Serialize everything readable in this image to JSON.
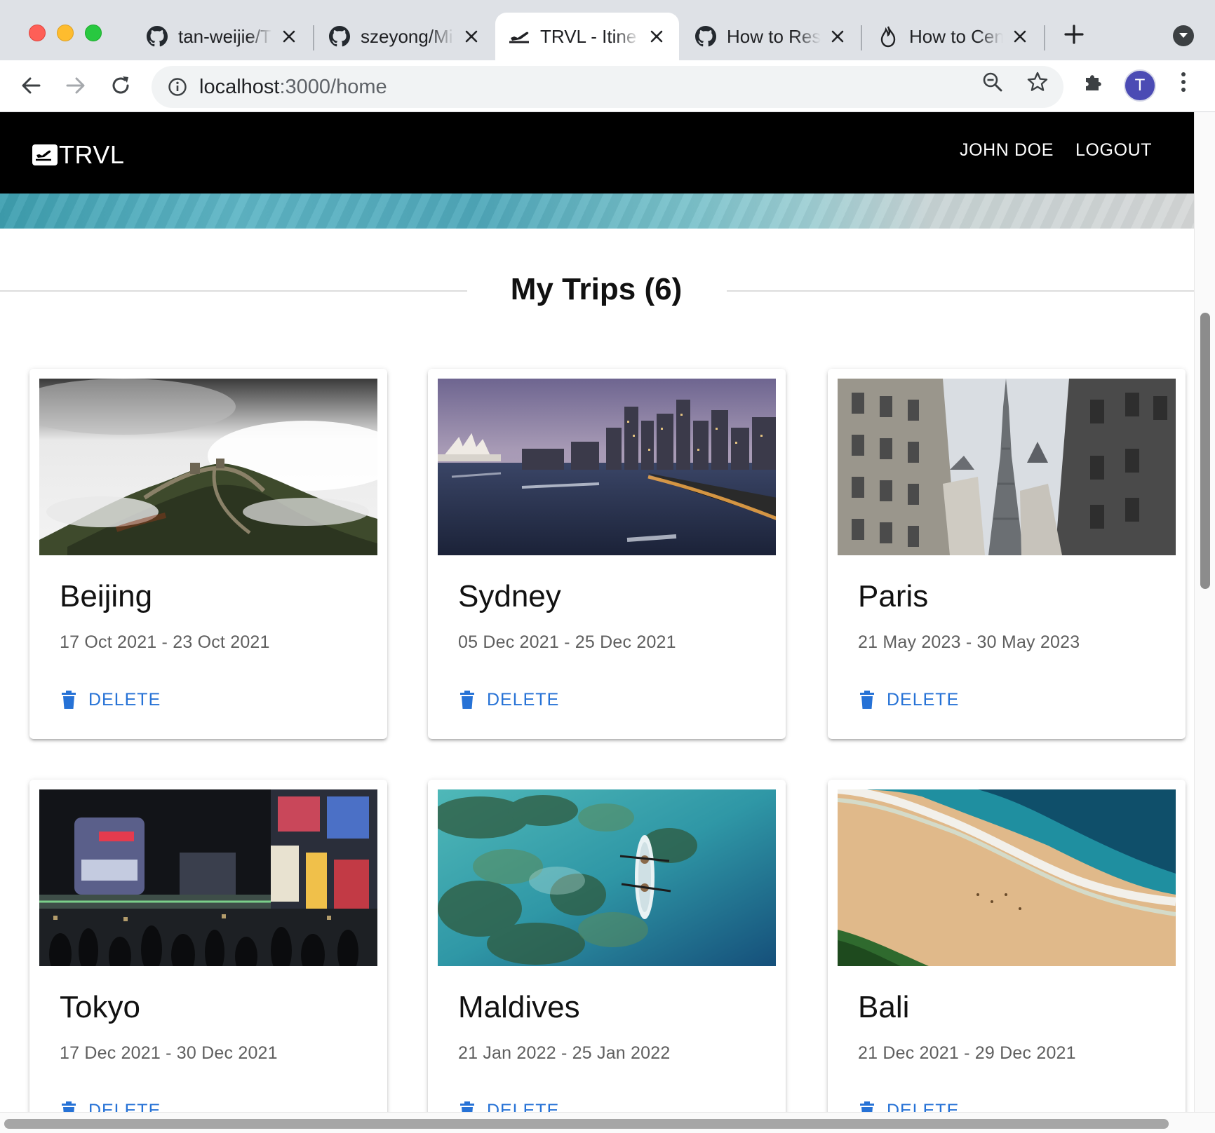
{
  "browser": {
    "tabs": [
      {
        "title": "tan-weijie/T",
        "icon": "github-icon",
        "active": false
      },
      {
        "title": "szeyong/Mi",
        "icon": "github-icon",
        "active": false
      },
      {
        "title": "TRVL - Itine",
        "icon": "plane-icon",
        "active": true
      },
      {
        "title": "How to Res",
        "icon": "github-icon",
        "active": false
      },
      {
        "title": "How to Cen",
        "icon": "flame-icon",
        "active": false
      }
    ],
    "url_host": "localhost",
    "url_path": ":3000/home",
    "profile_initial": "T"
  },
  "app": {
    "brand": "TRVL",
    "user_name": "JOHN DOE",
    "logout_label": "LOGOUT"
  },
  "page": {
    "title": "My Trips (6)",
    "delete_label": "DELETE",
    "trips": [
      {
        "name": "Beijing",
        "dates": "17 Oct 2021 - 23 Oct 2021",
        "image": "great-wall-in-clouds"
      },
      {
        "name": "Sydney",
        "dates": "05 Dec 2021 - 25 Dec 2021",
        "image": "sydney-harbour-at-dusk"
      },
      {
        "name": "Paris",
        "dates": "21 May 2023 - 30 May 2023",
        "image": "eiffel-tower-street"
      },
      {
        "name": "Tokyo",
        "dates": "17 Dec 2021 - 30 Dec 2021",
        "image": "shinjuku-night-street"
      },
      {
        "name": "Maldives",
        "dates": "21 Jan 2022 - 25 Jan 2022",
        "image": "kayak-over-reef"
      },
      {
        "name": "Bali",
        "dates": "21 Dec 2021 - 29 Dec 2021",
        "image": "beach-aerial"
      }
    ]
  },
  "colors": {
    "appbar": "#000000",
    "accent": "#2672d6",
    "tabstrip": "#dee1e6"
  }
}
